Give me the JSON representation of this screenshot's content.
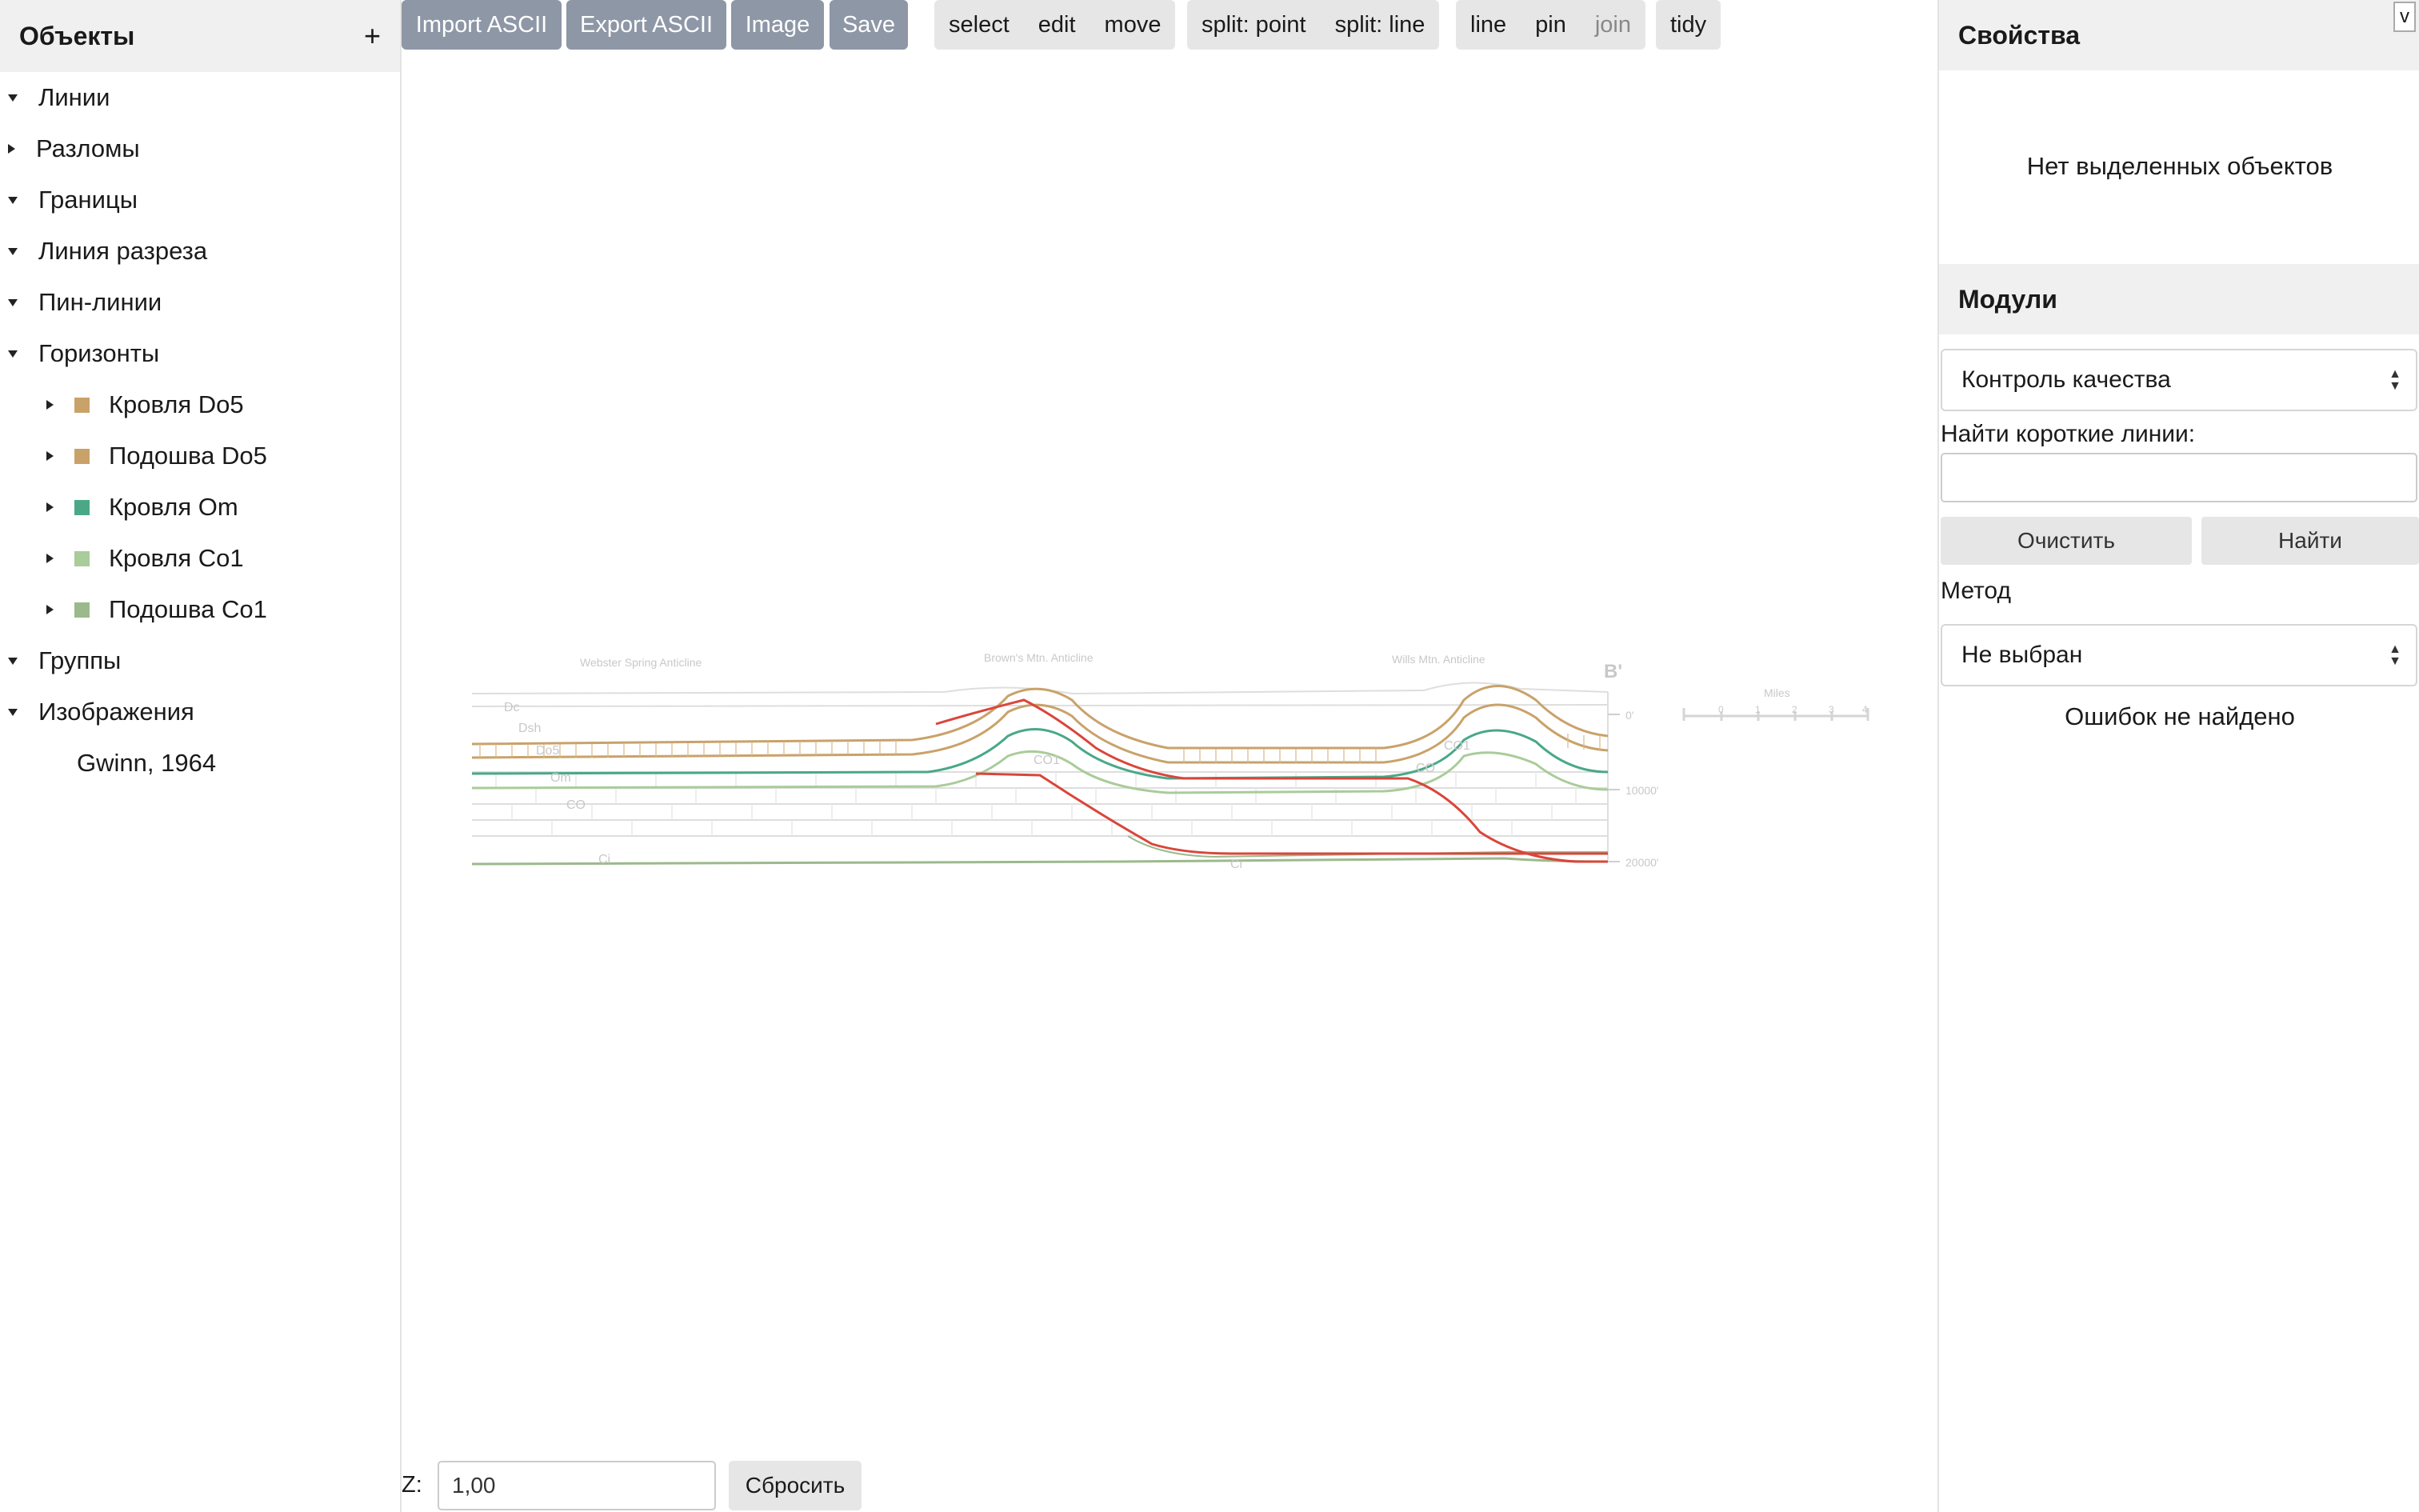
{
  "left_panel": {
    "title": "Объекты",
    "add_icon": "+",
    "tree": [
      {
        "label": "Линии",
        "expanded": true
      },
      {
        "label": "Разломы",
        "expanded": false
      },
      {
        "label": "Границы",
        "expanded": true
      },
      {
        "label": "Линия разреза",
        "expanded": true
      },
      {
        "label": "Пин-линии",
        "expanded": true
      },
      {
        "label": "Горизонты",
        "expanded": true,
        "children": [
          {
            "label": "Кровля Do5",
            "color": "#c9a26a"
          },
          {
            "label": "Подошва Do5",
            "color": "#c9a26a"
          },
          {
            "label": "Кровля Om",
            "color": "#4aa887"
          },
          {
            "label": "Кровля Co1",
            "color": "#a9cc9a"
          },
          {
            "label": "Подошва Co1",
            "color": "#9cb98c"
          }
        ]
      },
      {
        "label": "Группы",
        "expanded": true
      },
      {
        "label": "Изображения",
        "expanded": true,
        "children": [
          {
            "label": "Gwinn, 1964"
          }
        ]
      }
    ]
  },
  "toolbar": {
    "import": "Import ASCII",
    "export": "Export ASCII",
    "image": "Image",
    "save": "Save",
    "mode_select": "select",
    "mode_edit": "edit",
    "mode_move": "move",
    "split_point": "split: point",
    "split_line": "split: line",
    "line": "line",
    "pin": "pin",
    "join": "join",
    "tidy": "tidy"
  },
  "figure": {
    "labels": {
      "a1": "Webster Spring Anticline",
      "a2": "Brown's Mtn. Anticline",
      "a3": "Wills Mtn. Anticline",
      "b": "B'",
      "miles": "Miles",
      "depth0": "0'",
      "depth1": "10000'",
      "depth2": "20000'",
      "dc": "Dc",
      "dsh": "Dsh",
      "do5": "Do5",
      "om": "Om",
      "co": "CO",
      "co1": "CO1",
      "ci": "Ci",
      "ci2": "Ci",
      "co_b": "CO",
      "co1_b": "CO1",
      "s0": "0",
      "s1": "1",
      "s2": "2",
      "s3": "3",
      "s4": "4"
    },
    "colors": {
      "do5": "#c9a26a",
      "om": "#4aa887",
      "co1": "#a9cc9a",
      "fault": "#d9463b",
      "faint": "#dcdcdc"
    }
  },
  "zoom": {
    "label": "Z:",
    "value": "1,00",
    "reset": "Сбросить"
  },
  "right_panel": {
    "props_title": "Свойства",
    "no_selection": "Нет выделенных объектов",
    "modules_title": "Модули",
    "module_value": "Контроль качества",
    "find_short_label": "Найти короткие линии:",
    "find_short_value": "",
    "clear": "Очистить",
    "find": "Найти",
    "method_label": "Метод",
    "method_value": "Не выбран",
    "status": "Ошибок не найдено",
    "toggle": "v"
  }
}
